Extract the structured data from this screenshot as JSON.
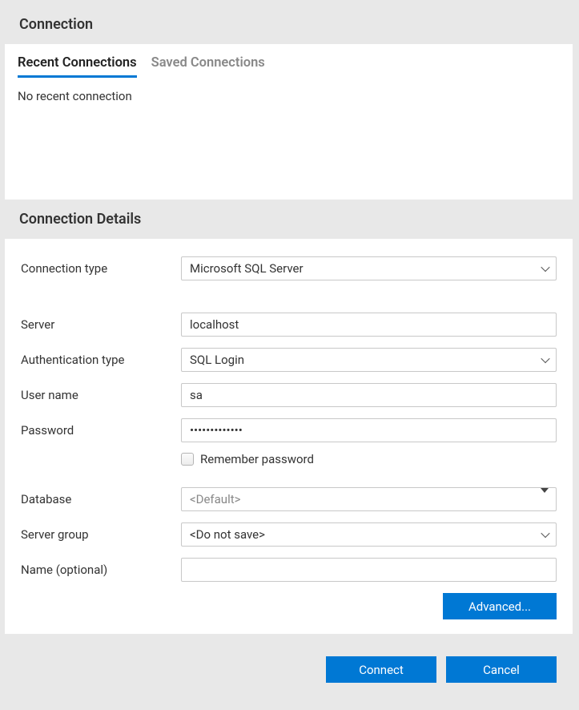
{
  "header": {
    "title": "Connection"
  },
  "tabs": {
    "recent": "Recent Connections",
    "saved": "Saved Connections",
    "empty_message": "No recent connection"
  },
  "details": {
    "title": "Connection Details",
    "labels": {
      "connection_type": "Connection type",
      "server": "Server",
      "auth_type": "Authentication type",
      "username": "User name",
      "password": "Password",
      "remember": "Remember password",
      "database": "Database",
      "server_group": "Server group",
      "name_optional": "Name (optional)"
    },
    "values": {
      "connection_type": "Microsoft SQL Server",
      "server": "localhost",
      "auth_type": "SQL Login",
      "username": "sa",
      "password": "•••••••••••••",
      "database": "<Default>",
      "server_group": "<Do not save>",
      "name_optional": ""
    }
  },
  "buttons": {
    "advanced": "Advanced...",
    "connect": "Connect",
    "cancel": "Cancel"
  }
}
